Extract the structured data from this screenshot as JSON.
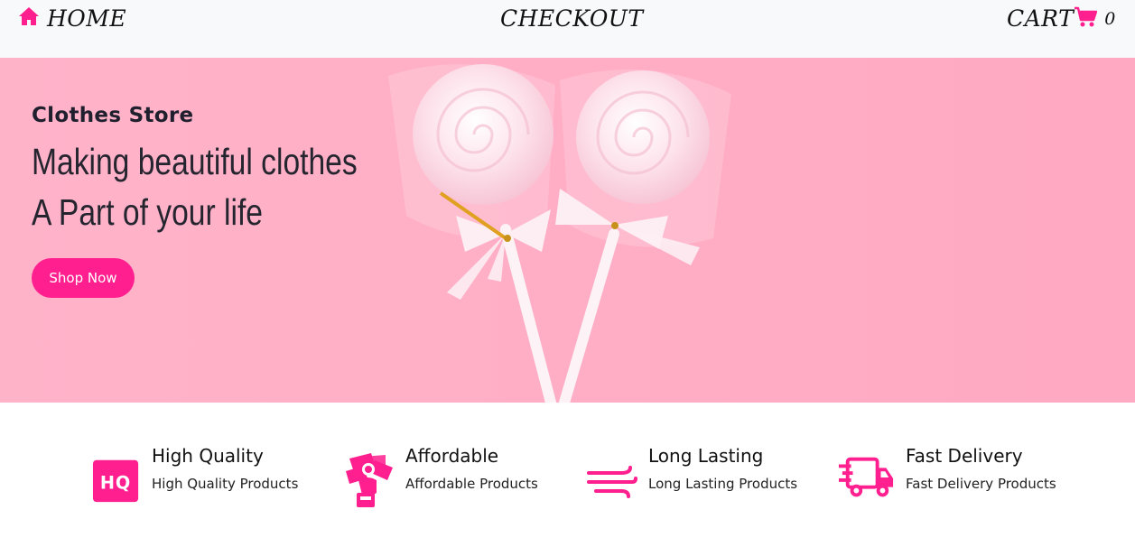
{
  "nav": {
    "home_label": "HOME",
    "checkout_label": "CHECKOUT",
    "cart_label": "CART",
    "cart_count": "0",
    "home_icon": "home-icon",
    "cart_icon": "shopping-cart-icon"
  },
  "hero": {
    "subtitle": "Clothes Store",
    "title_line1": "Making beautiful clothes",
    "title_line2": "A Part of your life",
    "cta_label": "Shop Now",
    "background_color": "#ffaec5"
  },
  "features": [
    {
      "title": "High Quality",
      "desc": "High Quality Products",
      "icon": "hq-badge-icon"
    },
    {
      "title": "Affordable",
      "desc": "Affordable Products",
      "icon": "money-hand-icon"
    },
    {
      "title": "Long Lasting",
      "desc": "Long Lasting Products",
      "icon": "wind-lines-icon"
    },
    {
      "title": "Fast Delivery",
      "desc": "Fast Delivery Products",
      "icon": "delivery-truck-icon"
    }
  ],
  "colors": {
    "accent": "#ff1f8e",
    "nav_bg": "#f8f9fa",
    "text_dark": "#25252f"
  }
}
